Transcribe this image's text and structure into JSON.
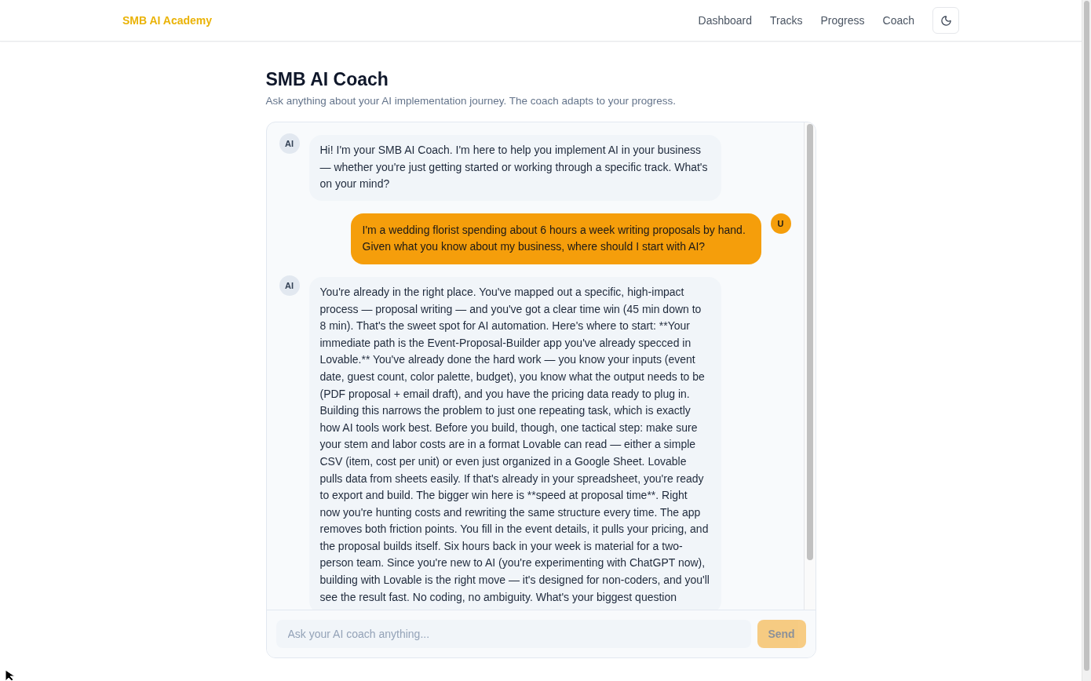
{
  "header": {
    "logo": "SMB AI Academy",
    "nav": [
      "Dashboard",
      "Tracks",
      "Progress",
      "Coach"
    ]
  },
  "page": {
    "title": "SMB AI Coach",
    "subtitle": "Ask anything about your AI implementation journey. The coach adapts to your progress."
  },
  "chat": {
    "messages": [
      {
        "kind": "assistant",
        "avatar": "AI",
        "text": "Hi! I'm your SMB AI Coach. I'm here to help you implement AI in your business — whether you're just getting started or working through a specific track. What's on your mind?"
      },
      {
        "kind": "user",
        "avatar": "U",
        "text": "I'm a wedding florist spending about 6 hours a week writing proposals by hand. Given what you know about my business, where should I start with AI?"
      },
      {
        "kind": "assistant",
        "avatar": "AI",
        "text": "You're already in the right place. You've mapped out a specific, high-impact process — proposal writing — and you've got a clear time win (45 min down to 8 min). That's the sweet spot for AI automation. Here's where to start: **Your immediate path is the Event-Proposal-Builder app you've already specced in Lovable.** You've already done the hard work — you know your inputs (event date, guest count, color palette, budget), you know what the output needs to be (PDF proposal + email draft), and you have the pricing data ready to plug in. Building this narrows the problem to just one repeating task, which is exactly how AI tools work best. Before you build, though, one tactical step: make sure your stem and labor costs are in a format Lovable can read — either a simple CSV (item, cost per unit) or even just organized in a Google Sheet. Lovable pulls data from sheets easily. If that's already in your spreadsheet, you're ready to export and build. The bigger win here is **speed at proposal time**. Right now you're hunting costs and rewriting the same structure every time. The app removes both friction points. You fill in the event details, it pulls your pricing, and the proposal builds itself. Six hours back in your week is material for a two-person team. Since you're new to AI (you're experimenting with ChatGPT now), building with Lovable is the right move — it's designed for non-coders, and you'll see the result fast. No coding, no ambiguity. What's your biggest question"
      }
    ],
    "composer": {
      "placeholder": "Ask your AI coach anything...",
      "send_label": "Send",
      "disabled": true
    }
  }
}
